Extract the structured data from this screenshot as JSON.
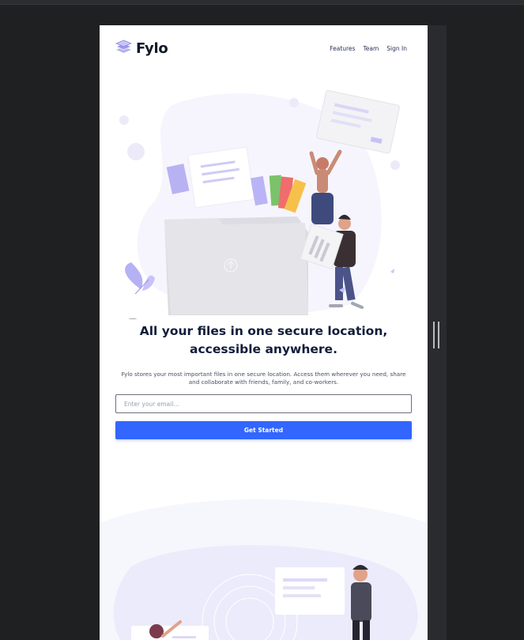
{
  "brand": {
    "name": "Fylo",
    "logo_icon": "stacked-layers-icon"
  },
  "nav": {
    "items": [
      {
        "label": "Features"
      },
      {
        "label": "Team"
      },
      {
        "label": "Sign In"
      }
    ]
  },
  "hero": {
    "headline": "All your files in one secure location, accessible anywhere.",
    "description": "Fylo stores your most important files in one secure location. Access them wherever you need, share and collaborate with friends, family, and co-workers.",
    "email_placeholder": "Enter your email...",
    "cta_label": "Get Started",
    "illustration_icon": "file-folder-upload-illustration"
  },
  "colors": {
    "accent": "#3366ff",
    "heading": "#121c3b",
    "text": "#4a4f63",
    "background": "#ffffff",
    "section_bg": "#f5f7ff",
    "chrome": "#1f2022"
  }
}
